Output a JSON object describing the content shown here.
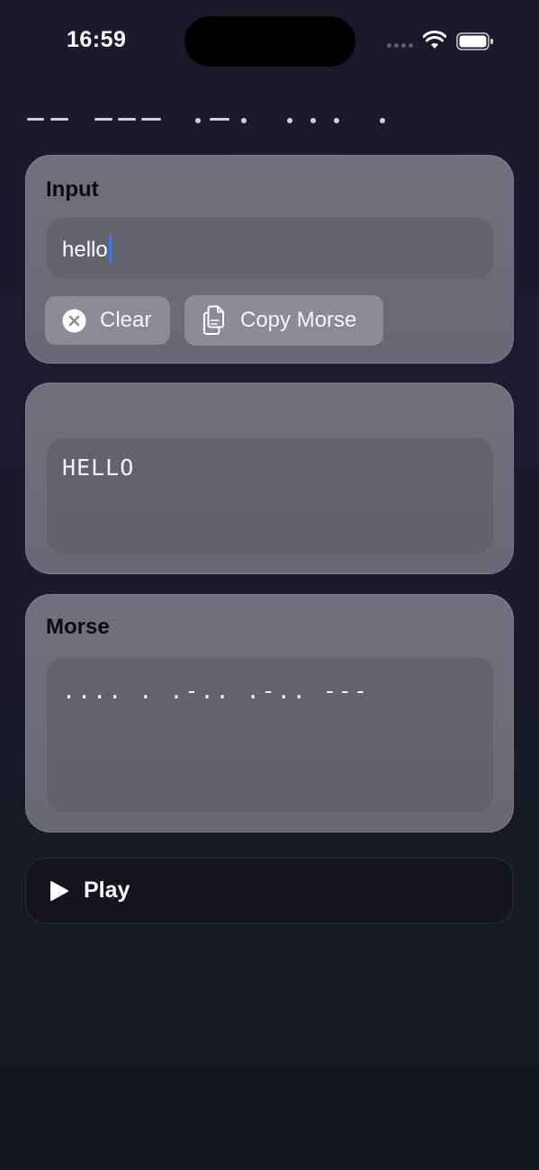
{
  "status_bar": {
    "time": "16:59",
    "icons": [
      "signal-icon",
      "wifi-icon",
      "battery-icon"
    ]
  },
  "header": {
    "morse_title": "-- --- .-. ... ."
  },
  "input_card": {
    "title": "Input",
    "input_value": "hello",
    "clear_label": "Clear",
    "copy_label": "Copy Morse",
    "clear_icon": "x-circle-icon",
    "copy_icon": "copy-document-icon"
  },
  "text_card": {
    "value": "HELLO"
  },
  "morse_card": {
    "title": "Morse",
    "value": ".... . .-.. .-.. ---"
  },
  "play": {
    "label": "Play",
    "icon": "play-icon"
  },
  "colors": {
    "accent_cursor": "#2f7bf5",
    "card_background": "#78788a",
    "background": "#1a1a2b"
  }
}
